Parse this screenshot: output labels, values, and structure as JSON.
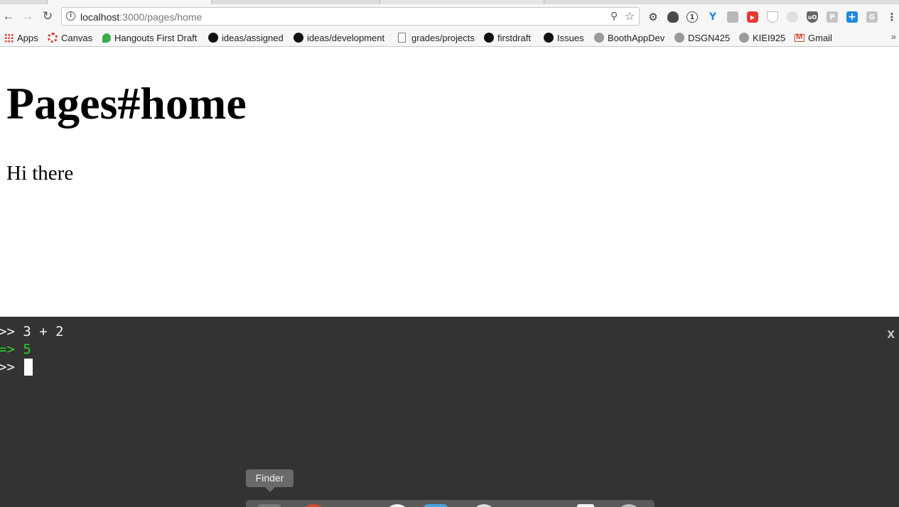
{
  "browser": {
    "url_host": "localhost",
    "url_path": ":3000/pages/home",
    "bookmarks": [
      {
        "label": "Apps",
        "icon": "apps-grid-icon"
      },
      {
        "label": "Canvas",
        "icon": "canvas-icon"
      },
      {
        "label": "Hangouts First Draft",
        "icon": "hangouts-icon"
      },
      {
        "label": "ideas/assigned",
        "icon": "github-icon"
      },
      {
        "label": "ideas/development",
        "icon": "github-icon"
      },
      {
        "label": "grades/projects",
        "icon": "file-icon"
      },
      {
        "label": "firstdraft",
        "icon": "github-icon"
      },
      {
        "label": "Issues",
        "icon": "github-icon"
      },
      {
        "label": "BoothAppDev",
        "icon": "chat-bubble-icon"
      },
      {
        "label": "DSGN425",
        "icon": "chat-bubble-icon"
      },
      {
        "label": "KIEI925",
        "icon": "chat-bubble-icon"
      },
      {
        "label": "Gmail",
        "icon": "gmail-icon"
      }
    ],
    "more_label": "»",
    "extension_colors": {
      "gear": "#333333",
      "evernote": "#333333",
      "onepassword": "#333333",
      "yelp": "#1e88e5",
      "youtube": "#e53935",
      "ublock": "#555555",
      "plus": "#1e88e5"
    }
  },
  "page": {
    "title": "Pages#home",
    "greeting": "Hi there"
  },
  "console": {
    "prompt": ">>",
    "result_prefix": "=>",
    "input_1": "3 + 2",
    "output_1": "5",
    "close_label": "x"
  },
  "dock": {
    "tooltip": "Finder"
  }
}
